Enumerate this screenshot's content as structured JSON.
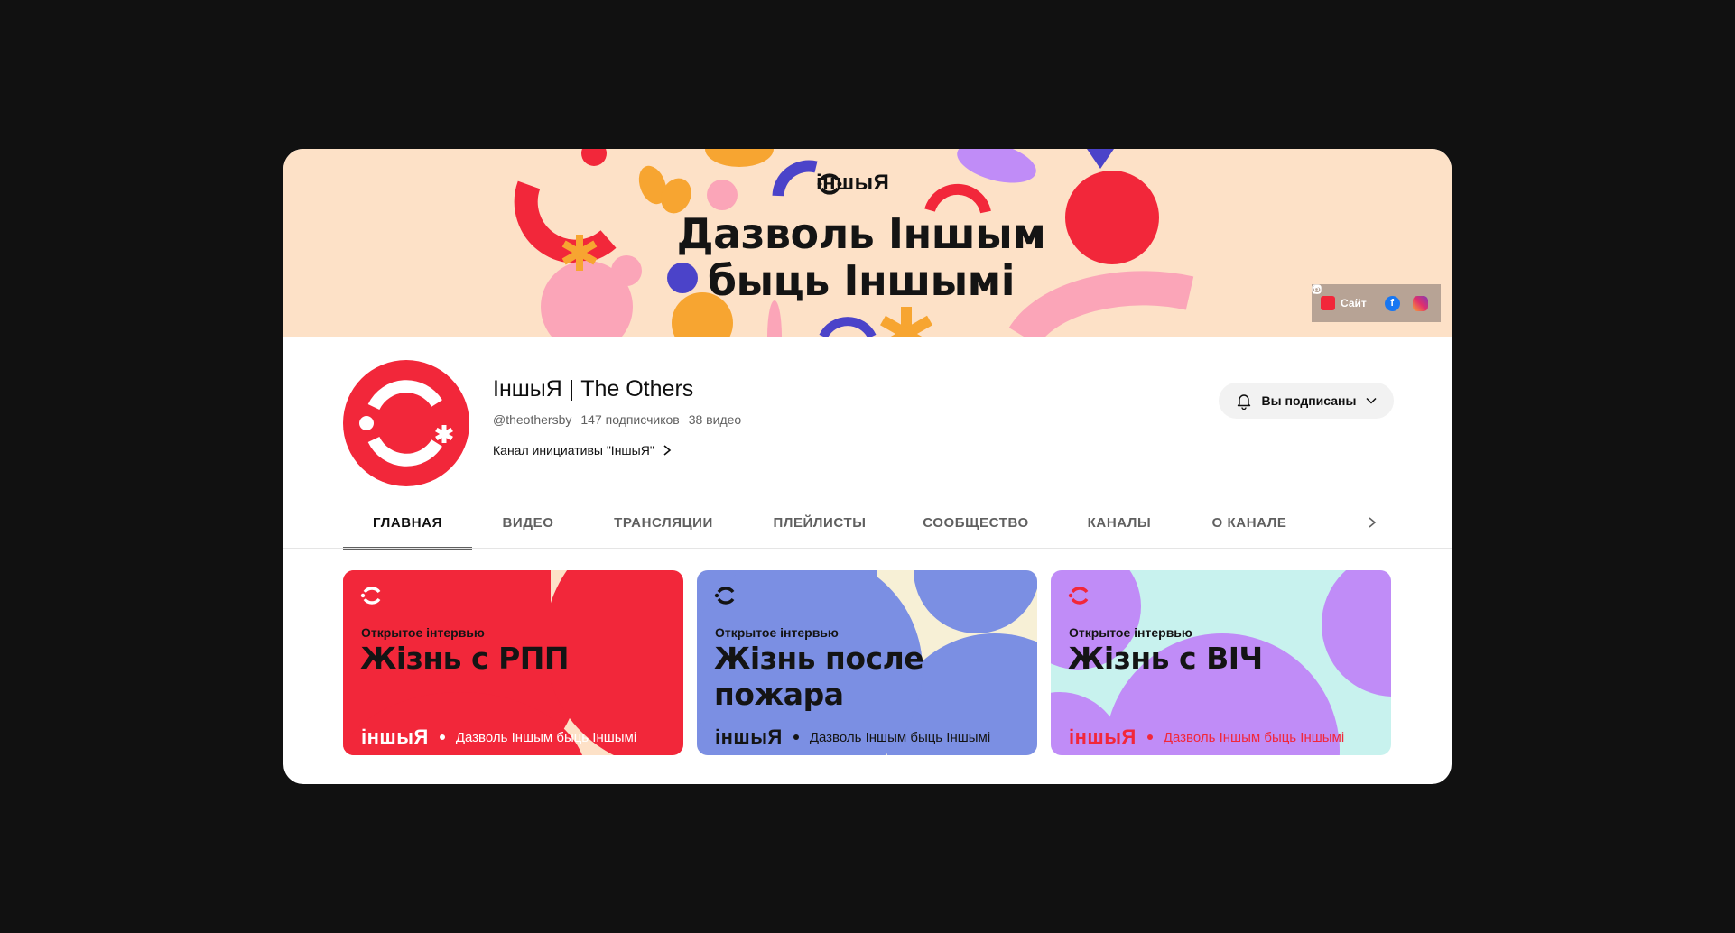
{
  "banner": {
    "brand": "іншыЯ",
    "title_line1": "Дазволь Іншым",
    "title_line2": "быць Іншымі",
    "links": {
      "site_label": "Сайт",
      "site_icon": "inshya-logo-icon",
      "facebook_icon": "facebook-icon",
      "instagram_icon": "instagram-icon"
    }
  },
  "channel": {
    "title": "ІншыЯ | The Others",
    "handle": "@theothersby",
    "subscribers": "147 подписчиков",
    "videos": "38 видео",
    "description": "Канал инициативы \"ІншыЯ\""
  },
  "subscribe": {
    "label": "Вы подписаны",
    "icon": "bell-icon"
  },
  "tabs": [
    {
      "label": "ГЛАВНАЯ",
      "active": true
    },
    {
      "label": "ВИДЕО"
    },
    {
      "label": "ТРАНСЛЯЦИИ"
    },
    {
      "label": "ПЛЕЙЛИСТЫ"
    },
    {
      "label": "СООБЩЕСТВО"
    },
    {
      "label": "КАНАЛЫ"
    },
    {
      "label": "О КАНАЛЕ"
    }
  ],
  "videos": [
    {
      "kicker": "Открытое інтервью",
      "title": "Жізнь с РПП",
      "brand": "іншыЯ",
      "slogan": "Дазволь Іншым быць Іншымі"
    },
    {
      "kicker": "Открытое інтервью",
      "title": "Жізнь после пожара",
      "brand": "іншыЯ",
      "slogan": "Дазволь Іншым быць Іншымі"
    },
    {
      "kicker": "Открытое інтервью",
      "title": "Жізнь с ВІЧ",
      "brand": "іншыЯ",
      "slogan": "Дазволь Іншым быць Іншымі"
    }
  ],
  "colors": {
    "brand_red": "#f2273a",
    "banner_bg": "#fde1c7",
    "periwinkle": "#7b8fe3",
    "lavender": "#c08cf7",
    "mint": "#c8f2ee",
    "cream": "#f7f0d6"
  }
}
